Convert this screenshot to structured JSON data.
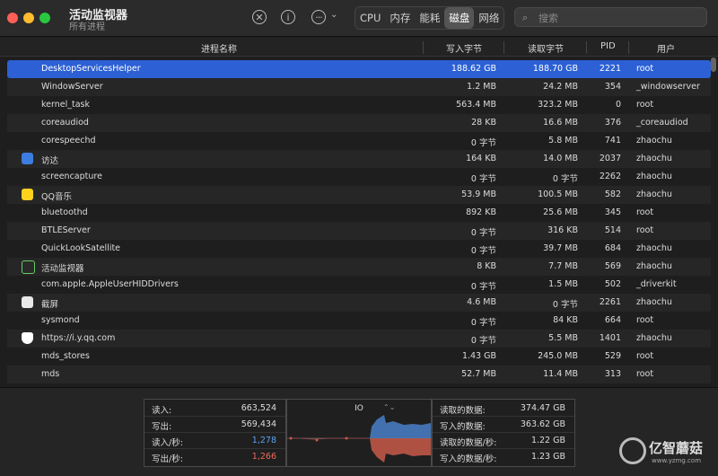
{
  "app": {
    "title": "活动监视器",
    "subtitle": "所有进程"
  },
  "tabs": [
    "CPU",
    "内存",
    "能耗",
    "磁盘",
    "网络"
  ],
  "active_tab": "磁盘",
  "search": {
    "placeholder": "搜索"
  },
  "columns": {
    "name": "进程名称",
    "written": "写入字节",
    "read": "读取字节",
    "pid": "PID",
    "user": "用户"
  },
  "processes": [
    {
      "name": "DesktopServicesHelper",
      "written": "188.62 GB",
      "read": "188.70 GB",
      "pid": "2221",
      "user": "root"
    },
    {
      "name": "WindowServer",
      "written": "1.2 MB",
      "read": "24.2 MB",
      "pid": "354",
      "user": "_windowserver"
    },
    {
      "name": "kernel_task",
      "written": "563.4 MB",
      "read": "323.2 MB",
      "pid": "0",
      "user": "root"
    },
    {
      "name": "coreaudiod",
      "written": "28 KB",
      "read": "16.6 MB",
      "pid": "376",
      "user": "_coreaudiod"
    },
    {
      "name": "corespeechd",
      "written": "0 字节",
      "read": "5.8 MB",
      "pid": "741",
      "user": "zhaochu"
    },
    {
      "name": "访达",
      "written": "164 KB",
      "read": "14.0 MB",
      "pid": "2037",
      "user": "zhaochu",
      "icon": "finder-icon"
    },
    {
      "name": "screencapture",
      "written": "0 字节",
      "read": "0 字节",
      "pid": "2262",
      "user": "zhaochu"
    },
    {
      "name": "QQ音乐",
      "written": "53.9 MB",
      "read": "100.5 MB",
      "pid": "582",
      "user": "zhaochu",
      "icon": "qqmusic-icon"
    },
    {
      "name": "bluetoothd",
      "written": "892 KB",
      "read": "25.6 MB",
      "pid": "345",
      "user": "root"
    },
    {
      "name": "BTLEServer",
      "written": "0 字节",
      "read": "316 KB",
      "pid": "514",
      "user": "root"
    },
    {
      "name": "QuickLookSatellite",
      "written": "0 字节",
      "read": "39.7 MB",
      "pid": "684",
      "user": "zhaochu"
    },
    {
      "name": "活动监视器",
      "written": "8 KB",
      "read": "7.7 MB",
      "pid": "569",
      "user": "zhaochu",
      "icon": "activity-monitor-icon"
    },
    {
      "name": "com.apple.AppleUserHIDDrivers",
      "written": "0 字节",
      "read": "1.5 MB",
      "pid": "502",
      "user": "_driverkit"
    },
    {
      "name": "截屏",
      "written": "4.6 MB",
      "read": "0 字节",
      "pid": "2261",
      "user": "zhaochu",
      "icon": "screenshot-icon"
    },
    {
      "name": "sysmond",
      "written": "0 字节",
      "read": "84 KB",
      "pid": "664",
      "user": "root"
    },
    {
      "name": "https://i.y.qq.com",
      "written": "0 字节",
      "read": "5.5 MB",
      "pid": "1401",
      "user": "zhaochu",
      "icon": "shield-icon"
    },
    {
      "name": "mds_stores",
      "written": "1.43 GB",
      "read": "245.0 MB",
      "pid": "529",
      "user": "root"
    },
    {
      "name": "mds",
      "written": "52.7 MB",
      "read": "11.4 MB",
      "pid": "313",
      "user": "root"
    }
  ],
  "stats_left": [
    {
      "label": "读入:",
      "value": "663,524",
      "color": "#dddddd"
    },
    {
      "label": "写出:",
      "value": "569,434",
      "color": "#dddddd"
    },
    {
      "label": "读入/秒:",
      "value": "1,278",
      "color": "#5aa2f0"
    },
    {
      "label": "写出/秒:",
      "value": "1,266",
      "color": "#f06a5a"
    }
  ],
  "io_chart": {
    "title": "IO",
    "read_color": "#4a7fc8",
    "write_color": "#c85a4a"
  },
  "stats_right": [
    {
      "label": "读取的数据:",
      "value": "374.47 GB"
    },
    {
      "label": "写入的数据:",
      "value": "363.62 GB"
    },
    {
      "label": "读取的数据/秒:",
      "value": "1.22 GB"
    },
    {
      "label": "写入的数据/秒:",
      "value": "1.23 GB"
    }
  ],
  "watermark": {
    "text": "亿智蘑菇",
    "url": "www.yzmg.com"
  }
}
